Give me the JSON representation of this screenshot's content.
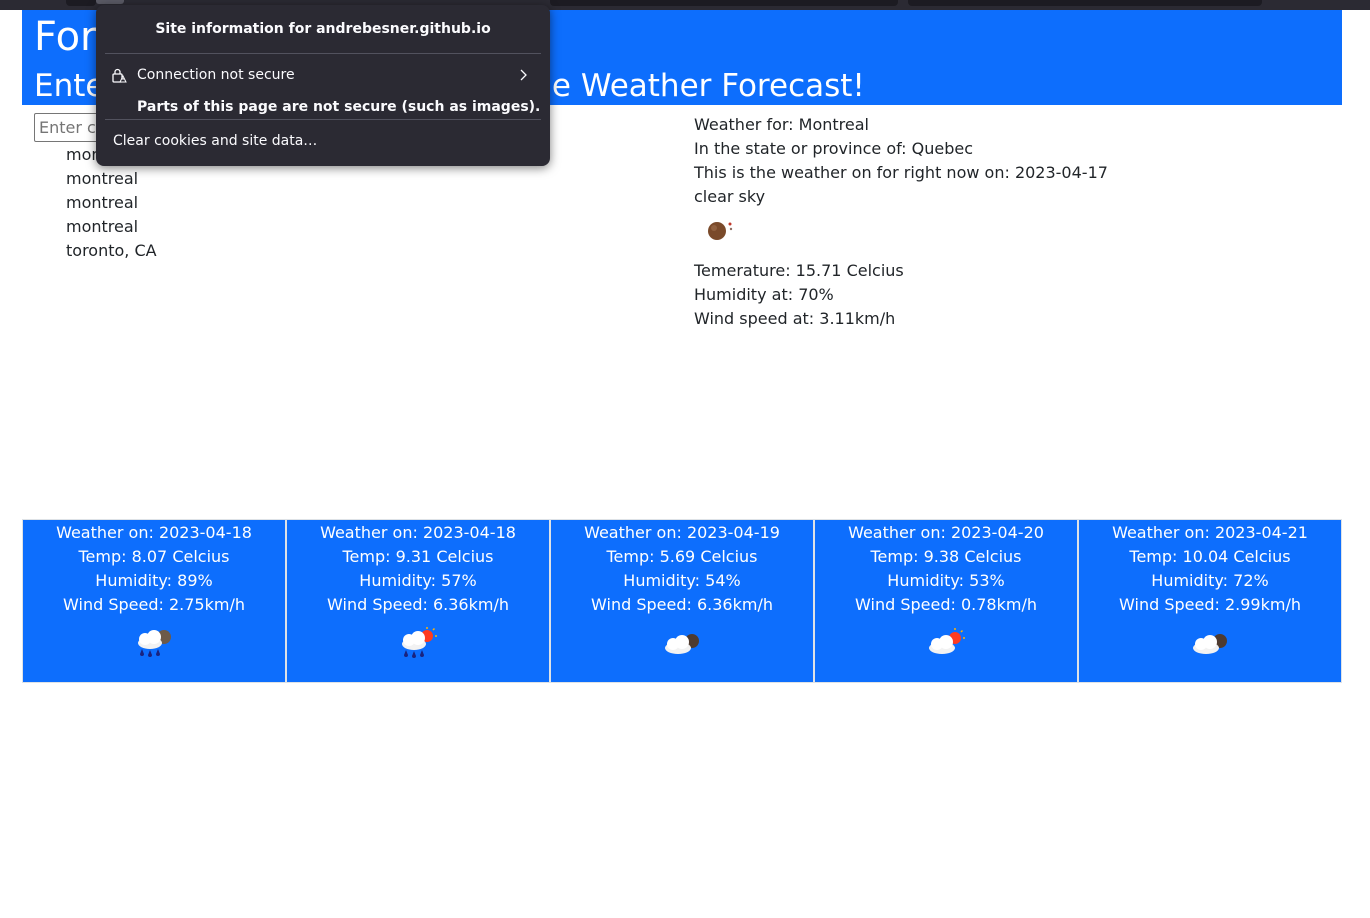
{
  "popup": {
    "title": "Site information for andrebesner.github.io",
    "connection_label": "Connection not secure",
    "warning": "Parts of this page are not secure (such as images).",
    "clear_cookies": "Clear cookies and site data…"
  },
  "header": {
    "title": "Forecast Dashboard",
    "subtitle": "Enter a City Name and Display the Weather Forecast!"
  },
  "search": {
    "placeholder": "Enter city",
    "value": ""
  },
  "history": [
    "montreal",
    "montreal",
    "montreal",
    "montreal",
    "toronto, CA"
  ],
  "current": {
    "city_line": "Weather for: Montreal",
    "region_line": "In the state or province of: Quebec",
    "date_line": "This is the weather on for right now on: 2023-04-17",
    "description": "clear sky",
    "icon": "clear-sky-night-icon",
    "temp_line": "Temerature: 15.71 Celcius",
    "humidity_line": "Humidity at: 70%",
    "wind_line": "Wind speed at: 3.11km/h"
  },
  "forecast": [
    {
      "date": "Weather on: 2023-04-18",
      "temp": "Temp: 8.07 Celcius",
      "humidity": "Humidity: 89%",
      "wind": "Wind Speed: 2.75km/h",
      "icon": "rain-night-icon"
    },
    {
      "date": "Weather on: 2023-04-18",
      "temp": "Temp: 9.31 Celcius",
      "humidity": "Humidity: 57%",
      "wind": "Wind Speed: 6.36km/h",
      "icon": "rain-day-icon"
    },
    {
      "date": "Weather on: 2023-04-19",
      "temp": "Temp: 5.69 Celcius",
      "humidity": "Humidity: 54%",
      "wind": "Wind Speed: 6.36km/h",
      "icon": "few-clouds-night-icon"
    },
    {
      "date": "Weather on: 2023-04-20",
      "temp": "Temp: 9.38 Celcius",
      "humidity": "Humidity: 53%",
      "wind": "Wind Speed: 0.78km/h",
      "icon": "few-clouds-day-icon"
    },
    {
      "date": "Weather on: 2023-04-21",
      "temp": "Temp: 10.04 Celcius",
      "humidity": "Humidity: 72%",
      "wind": "Wind Speed: 2.99km/h",
      "icon": "few-clouds-night-icon"
    }
  ],
  "colors": {
    "primary": "#0d6efd",
    "popup_bg": "#2b2a33"
  }
}
